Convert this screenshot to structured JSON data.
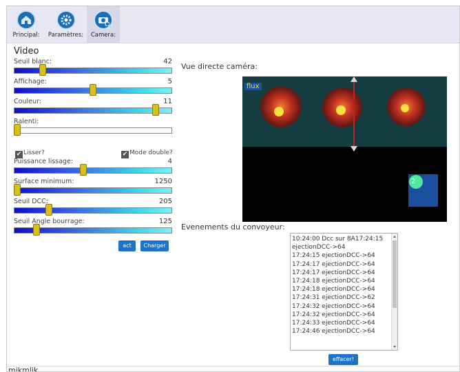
{
  "toolbar": {
    "items": [
      {
        "label": "Principal:",
        "icon": "home-icon"
      },
      {
        "label": "Paramètres:",
        "icon": "gear-icon"
      },
      {
        "label": "Camera:",
        "icon": "camera-icon",
        "active": true
      }
    ]
  },
  "video": {
    "title": "Video",
    "controls": [
      {
        "label": "Seuil blanc:",
        "value": "42",
        "percent": 18
      },
      {
        "label": "Affichage:",
        "value": "5",
        "percent": 50
      },
      {
        "label": "Couleur:",
        "value": "11",
        "percent": 90
      },
      {
        "label": "Ralenti:",
        "value": "",
        "percent": 0
      }
    ],
    "lisser_label": "Lisser?",
    "lisser_checked": true,
    "mode_double_label": "Mode double?",
    "mode_double_checked": true,
    "controls2": [
      {
        "label": "Puissance lissage:",
        "value": "4",
        "percent": 44
      },
      {
        "label": "Surface minimum:",
        "value": "1250",
        "percent": 0
      },
      {
        "label": "Seuil DCC:",
        "value": "205",
        "percent": 22
      },
      {
        "label": "Seuil Angle bourrage:",
        "value": "125",
        "percent": 14
      }
    ],
    "act_label": "act",
    "charger_label": "Charger"
  },
  "camera": {
    "title": "Vue directe caméra:",
    "flux_label": "flux",
    "object_number": "2"
  },
  "events": {
    "title": "Evenements du convoyeur:",
    "lines": [
      "10:24:00 Dcc sur 8A17:24:15",
      "ejectionDCC->64",
      "17:24:15 ejectionDCC->64",
      "17:24:17 ejectionDCC->64",
      "17:24:17 ejectionDCC->64",
      "17:24:18 ejectionDCC->64",
      "17:24:18 ejectionDCC->64",
      "17:24:31 ejectionDCC->62",
      "17:24:32 ejectionDCC->64",
      "17:24:32 ejectionDCC->64",
      "17:24:33 ejectionDCC->64",
      "17:24:46 ejectionDCC->64"
    ],
    "clear_label": "effacer!"
  },
  "footer": {
    "text": "mikmlik"
  },
  "colors": {
    "accent": "#1e73c9",
    "toolbar_bg": "#e8e8f4",
    "thumb": "#d8c21a"
  }
}
